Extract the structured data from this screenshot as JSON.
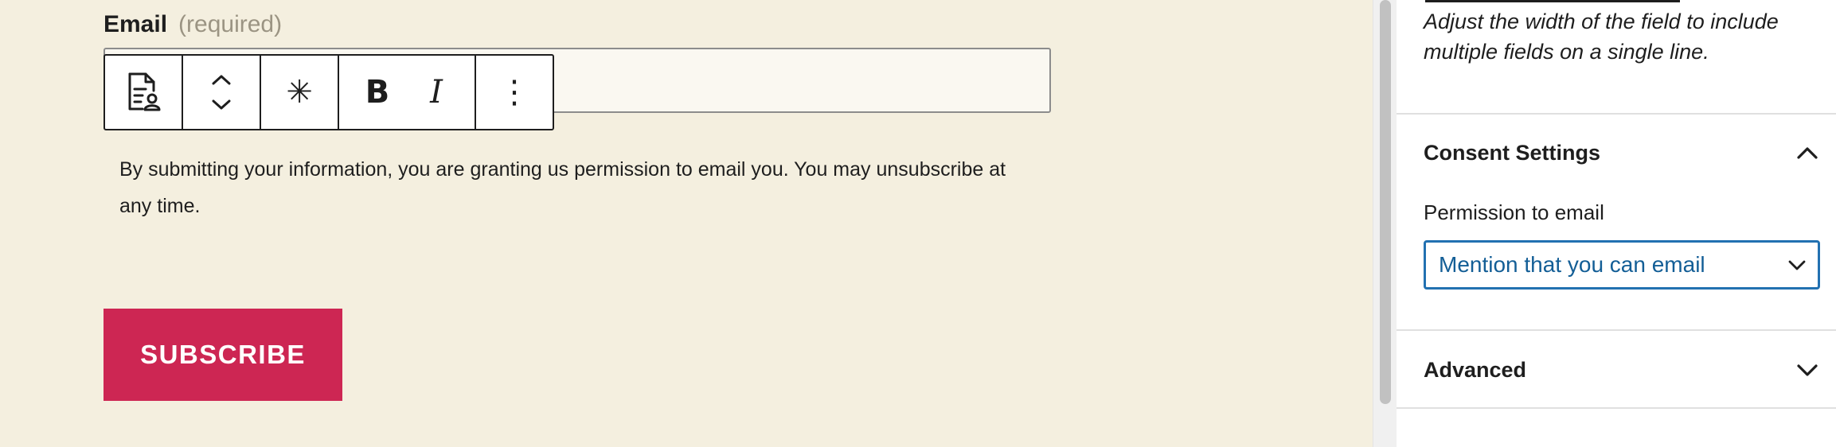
{
  "form": {
    "email_label": "Email",
    "required_text": "(required)",
    "consent_text": "By submitting your information, you are granting us permission to email you. You may unsubscribe at any time.",
    "subscribe_label": "SUBSCRIBE"
  },
  "toolbar": {
    "block_icon": "form-field-icon",
    "move_icon": "move-up-down-icon",
    "required_label": "✳",
    "bold_label": "B",
    "italic_label": "I",
    "more_label": "⋮"
  },
  "sidebar": {
    "width_help": "Adjust the width of the field to include multiple fields on a single line.",
    "consent_title": "Consent Settings",
    "permission_label": "Permission to email",
    "permission_value": "Mention that you can email",
    "advanced_title": "Advanced"
  },
  "colors": {
    "canvas_bg": "#f4efdf",
    "button_bg": "#cd2653",
    "select_border": "#2271b1",
    "select_text": "#135e96"
  }
}
